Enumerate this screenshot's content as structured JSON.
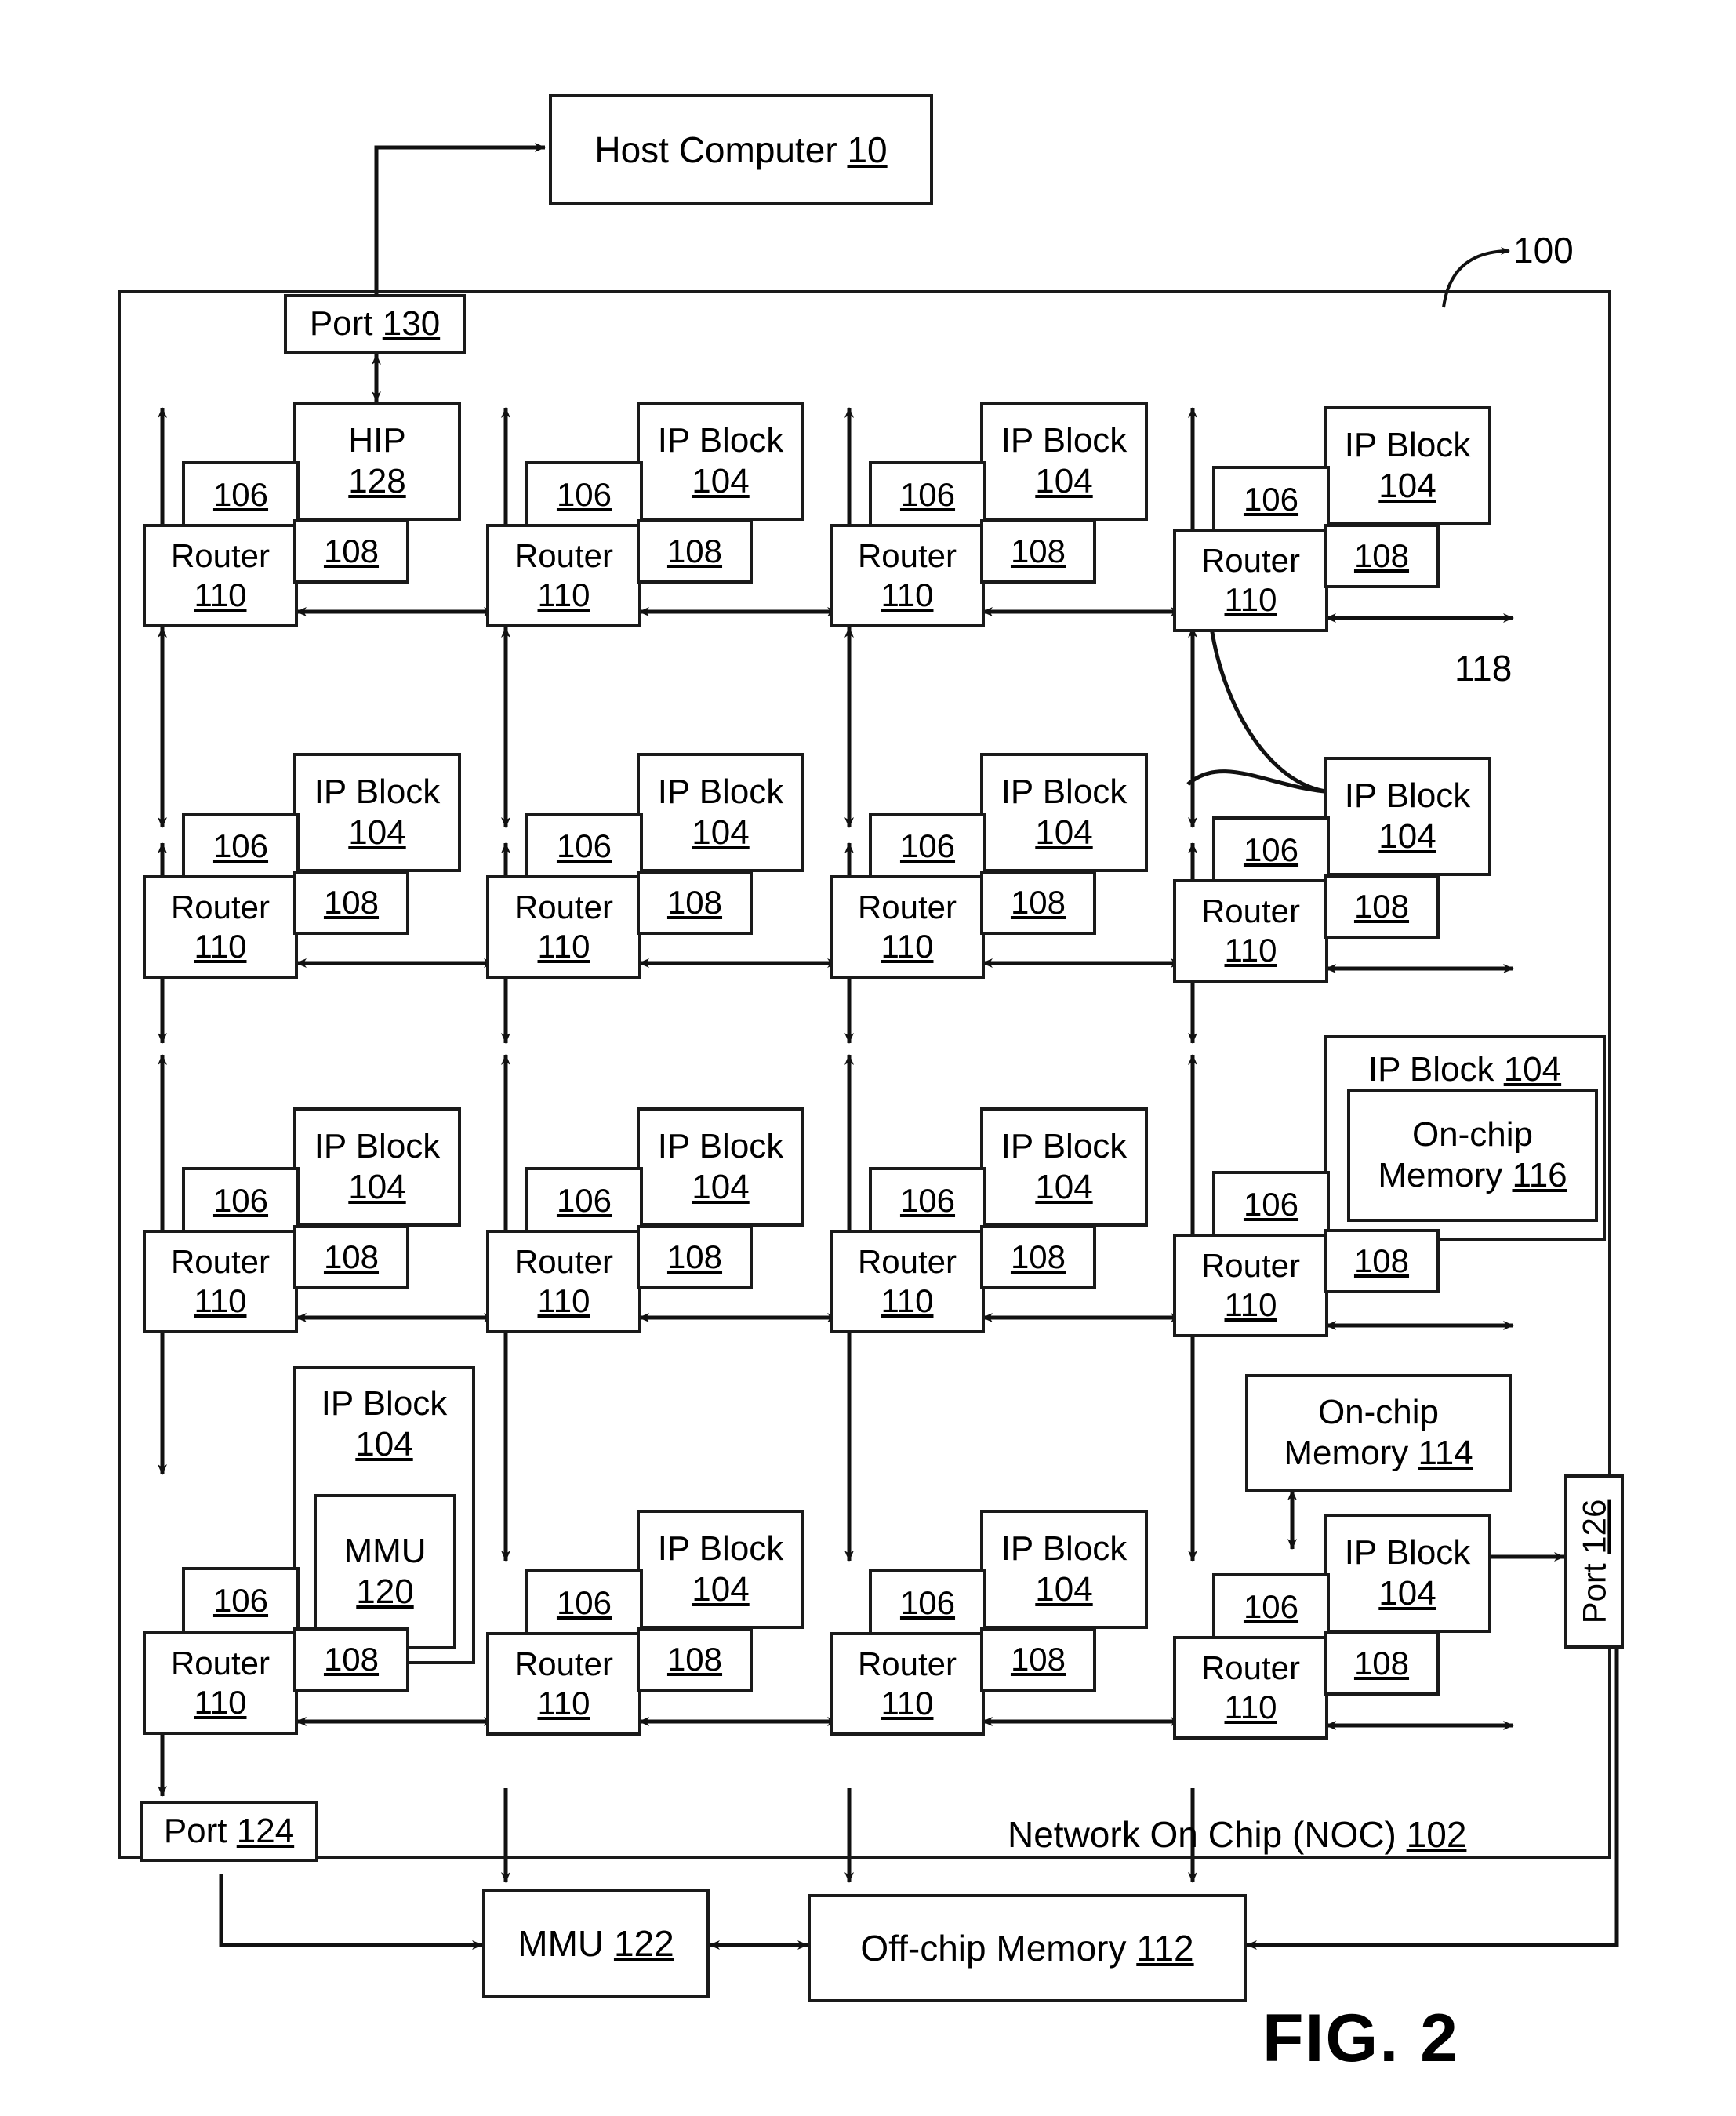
{
  "figure": {
    "caption": "FIG. 2",
    "ref_100": "100",
    "ref_118": "118"
  },
  "host": {
    "label": "Host Computer ",
    "ref": "10"
  },
  "noc": {
    "label": "Network On Chip (NOC) ",
    "ref": "102"
  },
  "ports": {
    "port130": {
      "label": "Port ",
      "ref": "130"
    },
    "port124": {
      "label": "Port ",
      "ref": "124"
    },
    "port126": {
      "label": "Port ",
      "ref": "126"
    }
  },
  "offchip": {
    "mmu122": {
      "label": "MMU ",
      "ref": "122"
    },
    "memory112": {
      "label": "Off-chip  Memory ",
      "ref": "112"
    }
  },
  "onchip_memories": {
    "memory114": {
      "line1": "On-chip",
      "line2": "Memory ",
      "ref": "114"
    }
  },
  "common": {
    "ip_block": "IP Block",
    "router": "Router",
    "ref_104": "104",
    "ref_106": "106",
    "ref_108": "108",
    "ref_110": "110",
    "hip": "HIP",
    "ref_128": "128",
    "mmu": "MMU",
    "ref_120": "120",
    "onchip_line1": "On-chip",
    "onchip_line2": "Memory ",
    "ref_116": "116",
    "ip_block_inline": "IP Block "
  },
  "nodes": [
    {
      "id": "r1c1",
      "block_type": "hip",
      "block_title": "HIP",
      "block_ref": "128",
      "nic": "106",
      "router": "Router",
      "router_ref": "110",
      "link_ref": "108"
    },
    {
      "id": "r1c2",
      "block_type": "ip",
      "block_title": "IP Block",
      "block_ref": "104",
      "nic": "106",
      "router": "Router",
      "router_ref": "110",
      "link_ref": "108"
    },
    {
      "id": "r1c3",
      "block_type": "ip",
      "block_title": "IP Block",
      "block_ref": "104",
      "nic": "106",
      "router": "Router",
      "router_ref": "110",
      "link_ref": "108"
    },
    {
      "id": "r1c4",
      "block_type": "ip",
      "block_title": "IP Block",
      "block_ref": "104",
      "nic": "106",
      "router": "Router",
      "router_ref": "110",
      "link_ref": "108"
    },
    {
      "id": "r2c1",
      "block_type": "ip",
      "block_title": "IP Block",
      "block_ref": "104",
      "nic": "106",
      "router": "Router",
      "router_ref": "110",
      "link_ref": "108"
    },
    {
      "id": "r2c2",
      "block_type": "ip",
      "block_title": "IP Block",
      "block_ref": "104",
      "nic": "106",
      "router": "Router",
      "router_ref": "110",
      "link_ref": "108"
    },
    {
      "id": "r2c3",
      "block_type": "ip",
      "block_title": "IP Block",
      "block_ref": "104",
      "nic": "106",
      "router": "Router",
      "router_ref": "110",
      "link_ref": "108"
    },
    {
      "id": "r2c4",
      "block_type": "ip",
      "block_title": "IP Block",
      "block_ref": "104",
      "nic": "106",
      "router": "Router",
      "router_ref": "110",
      "link_ref": "108"
    },
    {
      "id": "r3c1",
      "block_type": "ip",
      "block_title": "IP Block",
      "block_ref": "104",
      "nic": "106",
      "router": "Router",
      "router_ref": "110",
      "link_ref": "108"
    },
    {
      "id": "r3c2",
      "block_type": "ip",
      "block_title": "IP Block",
      "block_ref": "104",
      "nic": "106",
      "router": "Router",
      "router_ref": "110",
      "link_ref": "108"
    },
    {
      "id": "r3c3",
      "block_type": "ip",
      "block_title": "IP Block",
      "block_ref": "104",
      "nic": "106",
      "router": "Router",
      "router_ref": "110",
      "link_ref": "108"
    },
    {
      "id": "r3c4",
      "block_type": "onchip",
      "block_title": "IP Block 104",
      "block_ref": "116",
      "nic": "106",
      "router": "Router",
      "router_ref": "110",
      "link_ref": "108"
    },
    {
      "id": "r4c1",
      "block_type": "mmu",
      "block_title": "IP Block",
      "block_ref": "104",
      "nic": "106",
      "router": "Router",
      "router_ref": "110",
      "link_ref": "108"
    },
    {
      "id": "r4c2",
      "block_type": "ip",
      "block_title": "IP Block",
      "block_ref": "104",
      "nic": "106",
      "router": "Router",
      "router_ref": "110",
      "link_ref": "108"
    },
    {
      "id": "r4c3",
      "block_type": "ip",
      "block_title": "IP Block",
      "block_ref": "104",
      "nic": "106",
      "router": "Router",
      "router_ref": "110",
      "link_ref": "108"
    },
    {
      "id": "r4c4",
      "block_type": "ip",
      "block_title": "IP Block",
      "block_ref": "104",
      "nic": "106",
      "router": "Router",
      "router_ref": "110",
      "link_ref": "108"
    }
  ]
}
